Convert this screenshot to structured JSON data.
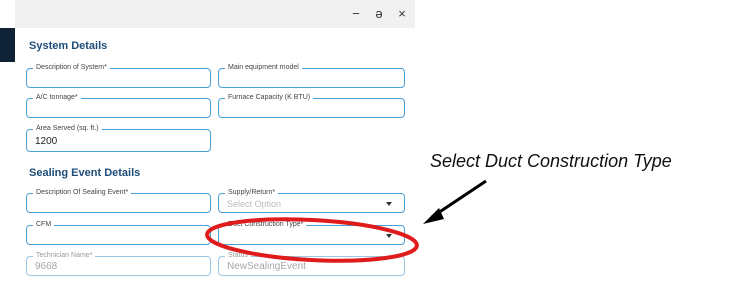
{
  "window": {
    "controls": {
      "minimize": "−",
      "restore": "ə",
      "close": "×"
    }
  },
  "system_details": {
    "title": "System Details",
    "description_label": "Description of System*",
    "main_equipment_label": "Main equipment model",
    "ac_tonnage_label": "A/C tonnage*",
    "furnace_capacity_label": "Furnace Capacity (K BTU)",
    "area_served_label": "Area Served (sq. ft.)",
    "area_served_value": "1200"
  },
  "sealing_event": {
    "title": "Sealing Event Details",
    "description_label": "Description Of Sealing Event*",
    "supply_return_label": "Supply/Return*",
    "supply_return_placeholder": "Select Option",
    "cfm_label": "CFM",
    "duct_construction_label": "Duct Construction Type*",
    "technician_label": "Technician Name*",
    "technician_value": "9668",
    "status_label": "Status",
    "status_value": "NewSealingEvent"
  },
  "annotation": {
    "text": "Select Duct Construction Type",
    "colors": {
      "circle": "#e01b1b",
      "arrow": "#000000"
    }
  },
  "colors": {
    "accent": "#4a9fd6",
    "section_title": "#1f4e79"
  }
}
